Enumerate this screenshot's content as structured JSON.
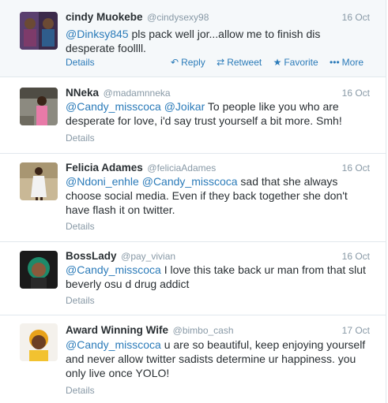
{
  "tweets": [
    {
      "fullname": "cindy Muokebe",
      "username": "@cindysexy98",
      "time": "16 Oct",
      "mentions": [
        "@Dinksy845"
      ],
      "text": " pls pack well jor...allow me to finish dis desperate foollll.",
      "details": "Details",
      "actions": {
        "reply": "Reply",
        "retweet": "Retweet",
        "favorite": "Favorite",
        "more": "More"
      }
    },
    {
      "fullname": "NNeka",
      "username": "@madamnneka",
      "time": "16 Oct",
      "mentions": [
        "@Candy_misscoca",
        "@Joikar"
      ],
      "text": " To people like you who are desperate for love, i'd say trust yourself a bit more. Smh!",
      "details": "Details"
    },
    {
      "fullname": "Felicia Adames",
      "username": "@feliciaAdames",
      "time": "16 Oct",
      "mentions": [
        "@Ndoni_enhle",
        "@Candy_misscoca"
      ],
      "text": " sad that she always choose social media. Even if they back together she don't have flash it on twitter.",
      "details": "Details"
    },
    {
      "fullname": "BossLady",
      "username": "@pay_vivian",
      "time": "16 Oct",
      "mentions": [
        "@Candy_misscoca"
      ],
      "text": " I love this take back ur man from that slut beverly osu d drug addict",
      "details": "Details"
    },
    {
      "fullname": "Award Winning Wife",
      "username": "@bimbo_cash",
      "time": "17 Oct",
      "mentions": [
        "@Candy_misscoca"
      ],
      "text": " u are so beautiful, keep enjoying yourself and never allow twitter sadists determine ur happiness. you only live once YOLO!",
      "details": "Details"
    }
  ],
  "icons": {
    "reply": "reply-arrow-icon",
    "retweet": "retweet-icon",
    "favorite": "star-icon",
    "more": "ellipsis-icon"
  },
  "colors": {
    "link": "#2b7bb9",
    "meta": "#8899a6",
    "text": "#292f33",
    "divider": "#e1e8ed"
  }
}
